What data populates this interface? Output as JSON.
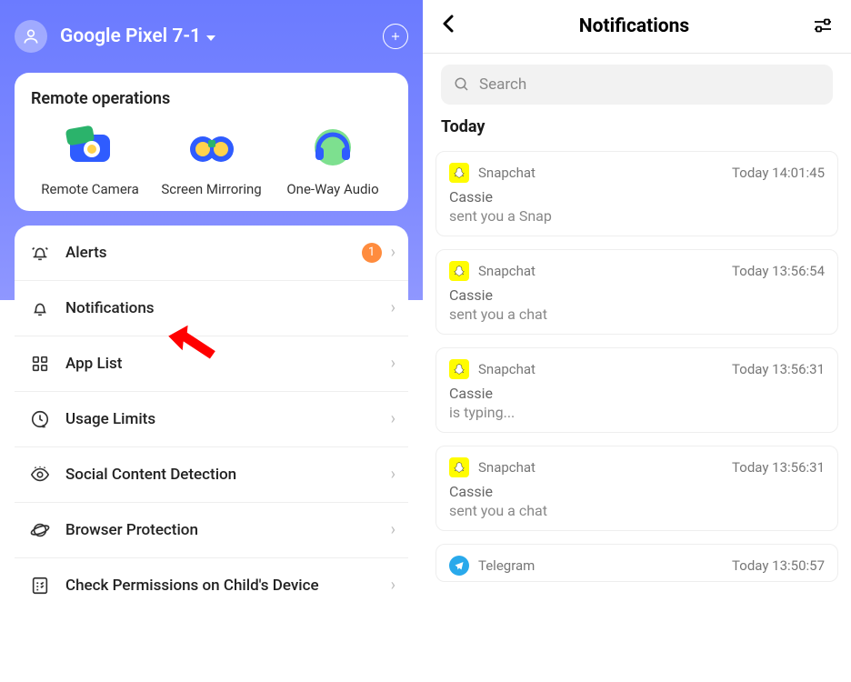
{
  "left": {
    "device_name": "Google Pixel 7-1",
    "remote_ops_title": "Remote operations",
    "remote_items": [
      {
        "label": "Remote Camera"
      },
      {
        "label": "Screen Mirroring"
      },
      {
        "label": "One-Way Audio"
      }
    ],
    "menu": [
      {
        "label": "Alerts",
        "badge": "1"
      },
      {
        "label": "Notifications"
      },
      {
        "label": "App List"
      },
      {
        "label": "Usage Limits"
      },
      {
        "label": "Social Content Detection"
      },
      {
        "label": "Browser Protection"
      },
      {
        "label": "Check Permissions on Child's Device"
      }
    ]
  },
  "right": {
    "title": "Notifications",
    "search_placeholder": "Search",
    "section_label": "Today",
    "notifications": [
      {
        "app": "Snapchat",
        "icon": "snapchat",
        "time": "Today 14:01:45",
        "sender": "Cassie",
        "body": "sent you a Snap"
      },
      {
        "app": "Snapchat",
        "icon": "snapchat",
        "time": "Today 13:56:54",
        "sender": "Cassie",
        "body": "sent you a chat"
      },
      {
        "app": "Snapchat",
        "icon": "snapchat",
        "time": "Today 13:56:31",
        "sender": "Cassie",
        "body": "is typing..."
      },
      {
        "app": "Snapchat",
        "icon": "snapchat",
        "time": "Today 13:56:31",
        "sender": "Cassie",
        "body": "sent you a chat"
      },
      {
        "app": "Telegram",
        "icon": "telegram",
        "time": "Today 13:50:57",
        "sender": "",
        "body": ""
      }
    ]
  }
}
